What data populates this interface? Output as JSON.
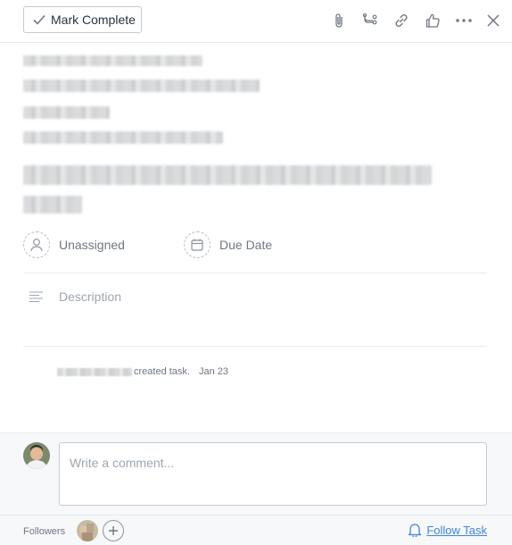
{
  "toolbar": {
    "mark_complete_label": "Mark Complete",
    "icons": [
      "attachment-icon",
      "subtask-icon",
      "link-icon",
      "like-icon",
      "more-icon",
      "close-icon"
    ]
  },
  "fields": {
    "assignee_label": "Unassigned",
    "due_date_label": "Due Date"
  },
  "description": {
    "placeholder": "Description"
  },
  "activity": {
    "action_text": "created task.",
    "date": "Jan 23"
  },
  "composer": {
    "placeholder": "Write a comment..."
  },
  "footer": {
    "followers_label": "Followers",
    "follow_task_label": "Follow Task"
  },
  "colors": {
    "accent": "#4186e0",
    "border": "#e8ecee",
    "muted_text": "#6f7782"
  }
}
